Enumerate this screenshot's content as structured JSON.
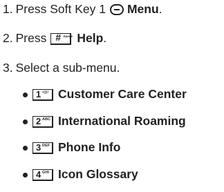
{
  "steps": [
    {
      "number": "1.",
      "text": "Press Soft Key 1",
      "icon": "soft-key-1-icon",
      "bold": "Menu",
      "suffix": "."
    },
    {
      "number": "2.",
      "text": "Press",
      "key_main": "#",
      "key_sub": "Space",
      "bold": "Help",
      "suffix": "."
    },
    {
      "number": "3.",
      "text": "Select a sub-menu."
    }
  ],
  "submenu": [
    {
      "key_main": "1",
      "key_sub": "•@/",
      "label": "Customer Care Center"
    },
    {
      "key_main": "2",
      "key_sub": "ABC",
      "label": "International Roaming"
    },
    {
      "key_main": "3",
      "key_sub": "DEF",
      "label": "Phone Info"
    },
    {
      "key_main": "4",
      "key_sub": "GHI",
      "label": "Icon Glossary"
    }
  ],
  "colors": {
    "text": "#231f20",
    "background": "#ffffff"
  }
}
